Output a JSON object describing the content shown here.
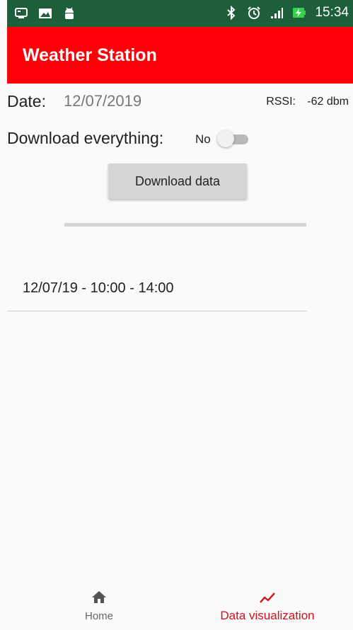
{
  "status_bar": {
    "time": "15:34",
    "left_icons": [
      "usb-icon",
      "image-icon",
      "android-icon"
    ],
    "right_icons": [
      "bluetooth-icon",
      "alarm-icon",
      "signal-icon",
      "battery-charging-icon"
    ]
  },
  "app_bar": {
    "title": "Weather Station",
    "color": "#ff0008"
  },
  "date_row": {
    "label": "Date:",
    "value": "12/07/2019",
    "rssi_label": "RSSI:",
    "rssi_value": "-62 dbm"
  },
  "download_all": {
    "label": "Download everything:",
    "state_text": "No",
    "enabled": false
  },
  "download_button": {
    "label": "Download data"
  },
  "progress": {
    "value": 0
  },
  "list": {
    "items": [
      {
        "label": "12/07/19 - 10:00 - 14:00"
      }
    ]
  },
  "bottom_nav": {
    "items": [
      {
        "label": "Home",
        "icon": "home-icon",
        "active": false
      },
      {
        "label": "Data visualization",
        "icon": "trending-up-icon",
        "active": true
      }
    ],
    "active_color": "#d50f1a"
  }
}
